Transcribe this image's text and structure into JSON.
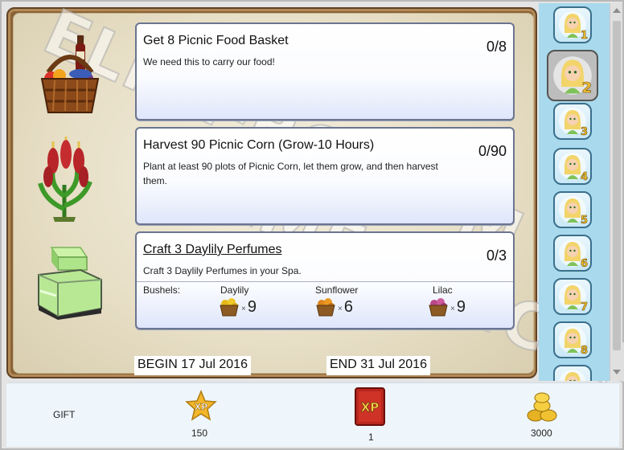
{
  "tasks": [
    {
      "title": "Get 8 Picnic Food Basket",
      "description": "We need this to carry our food!",
      "progress": "0/8",
      "icon": "picnic-basket-icon"
    },
    {
      "title": "Harvest 90 Picnic Corn (Grow-10 Hours)",
      "description": "Plant at least 90 plots of Picnic Corn, let them grow, and then harvest them.",
      "progress": "0/90",
      "icon": "picnic-corn-icon"
    },
    {
      "title": "Craft 3 Daylily Perfumes",
      "description": "Craft 3 Daylily Perfumes in your Spa.",
      "progress": "0/3",
      "icon": "perfume-bottle-icon",
      "bushels_label": "Bushels:",
      "bushels": [
        {
          "name": "Daylily",
          "qty": "9",
          "color": "#e6b818"
        },
        {
          "name": "Sunflower",
          "qty": "6",
          "color": "#e0841c"
        },
        {
          "name": "Lilac",
          "qty": "9",
          "color": "#b8488a"
        }
      ]
    }
  ],
  "dates": {
    "begin": "BEGIN 17 Jul 2016",
    "end": "END 31 Jul 2016"
  },
  "chapters": [
    "1",
    "2",
    "3",
    "4",
    "5",
    "6",
    "7",
    "8",
    ""
  ],
  "active_chapter": "2",
  "rewards": {
    "gift": "GIFT",
    "xp": "150",
    "xp_icon_text": "XP",
    "book": "1",
    "book_icon_text": "XP",
    "coins": "3000"
  },
  "watermark": "ELME-BG.COM"
}
